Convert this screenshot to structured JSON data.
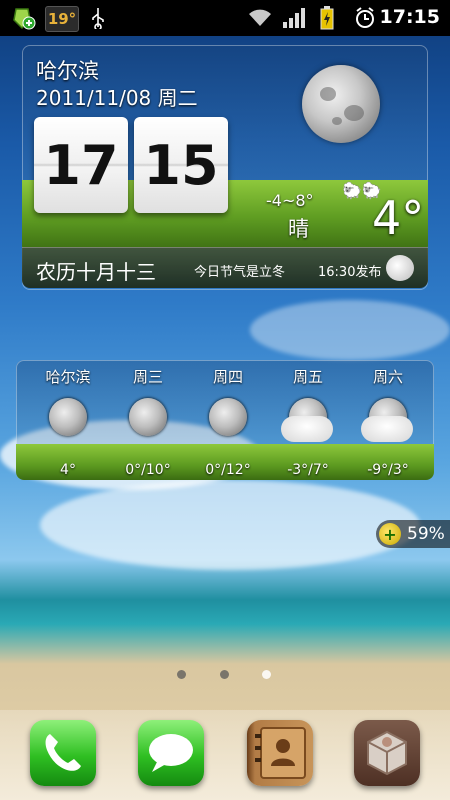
{
  "status_bar": {
    "temperature": "19°",
    "time": "17:15",
    "icons": [
      "shield-plus-icon",
      "usb-icon",
      "wifi-icon",
      "signal-icon",
      "battery-charging-icon",
      "alarm-icon"
    ]
  },
  "clock_widget": {
    "city": "哈尔滨",
    "date": "2011/11/08 周二",
    "hour": "17",
    "minute": "15",
    "temp_range": "-4~8°",
    "condition": "晴",
    "temp_now": "4°",
    "lunar_date": "农历十月十三",
    "solar_term": "今日节气是立冬",
    "published": "16:30发布"
  },
  "forecast": [
    {
      "name": "哈尔滨",
      "temp": "4°",
      "icon": "moon-icon"
    },
    {
      "name": "周三",
      "temp": "0°/10°",
      "icon": "moon-icon"
    },
    {
      "name": "周四",
      "temp": "0°/12°",
      "icon": "moon-icon"
    },
    {
      "name": "周五",
      "temp": "-3°/7°",
      "icon": "moon-cloud-icon"
    },
    {
      "name": "周六",
      "temp": "-9°/3°",
      "icon": "moon-cloud-icon"
    }
  ],
  "battery_badge": {
    "value": "59%"
  },
  "pages": {
    "count": 3,
    "active": 3
  },
  "dock": [
    "phone-icon",
    "messages-icon",
    "contacts-icon",
    "app-box-icon"
  ]
}
